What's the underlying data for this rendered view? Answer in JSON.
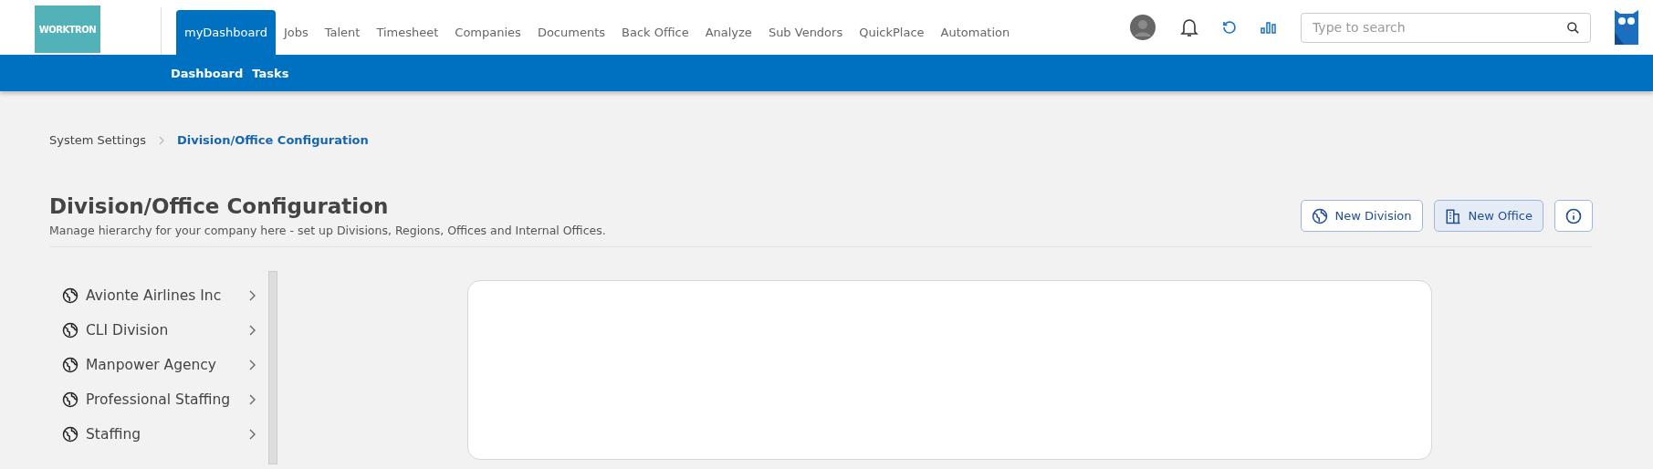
{
  "logo": {
    "text": "WORKTRON"
  },
  "nav": {
    "items": [
      {
        "label": "myDashboard",
        "selected": true
      },
      {
        "label": "Jobs",
        "selected": false
      },
      {
        "label": "Talent",
        "selected": false
      },
      {
        "label": "Timesheet",
        "selected": false
      },
      {
        "label": "Companies",
        "selected": false
      },
      {
        "label": "Documents",
        "selected": false
      },
      {
        "label": "Back Office",
        "selected": false
      },
      {
        "label": "Analyze",
        "selected": false
      },
      {
        "label": "Sub Vendors",
        "selected": false
      },
      {
        "label": "QuickPlace",
        "selected": false
      },
      {
        "label": "Automation",
        "selected": false
      }
    ],
    "subnav": [
      "Dashboard",
      "Tasks"
    ]
  },
  "search": {
    "placeholder": "Type to search"
  },
  "breadcrumb": [
    {
      "label": "System Settings",
      "selected": false
    },
    {
      "label": "Division/Office Configuration",
      "selected": true
    }
  ],
  "page": {
    "title": "Division/Office Configuration",
    "subtitle": "Manage hierarchy for your company here - set up Divisions, Regions, Offices and Internal Offices."
  },
  "actions": [
    {
      "kind": "division",
      "label": "New Division",
      "highlighted": false
    },
    {
      "kind": "office",
      "label": "New Office",
      "highlighted": true
    },
    {
      "kind": "info",
      "highlighted": false
    }
  ],
  "tree": [
    {
      "label": "Avionte Airlines Inc"
    },
    {
      "label": "CLI Division"
    },
    {
      "label": "Manpower Agency"
    },
    {
      "label": "Professional Staffing"
    },
    {
      "label": "Staffing"
    }
  ]
}
